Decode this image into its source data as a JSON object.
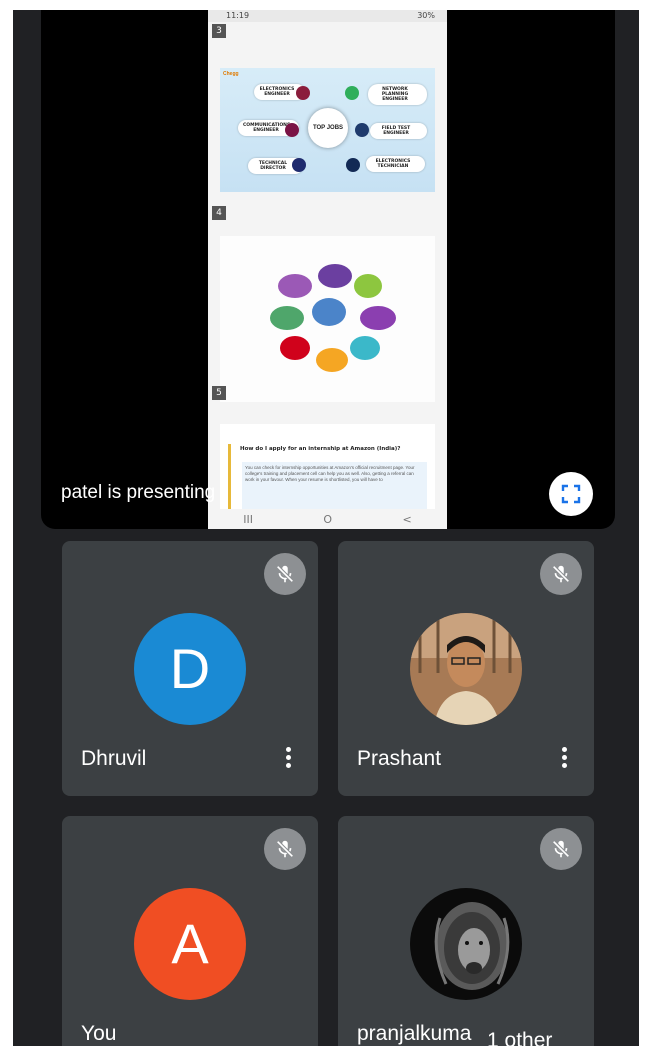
{
  "presentation": {
    "status_time": "11:19",
    "status_right": "30%",
    "pages": [
      "3",
      "4",
      "5"
    ],
    "slide1": {
      "logo": "Chegg",
      "hub": "TOP JOBS",
      "jobs": [
        "ELECTRONICS ENGINEER",
        "NETWORK PLANNING ENGINEER",
        "COMMUNICATIONS ENGINEER",
        "FIELD TEST ENGINEER",
        "TECHNICAL DIRECTOR",
        "ELECTRONICS TECHNICIAN"
      ]
    },
    "slide3": {
      "title": "How do I apply for an internship at Amazon (India)?",
      "body": "You can check for internship opportunities at Amazon's official recruitment page. Your college's training and placement cell can help you as well. Also, getting a referral can work in your favour. When your resume is shortlisted, you will have to"
    },
    "presenting_label": "patel is presenting",
    "fullscreen_icon": "fullscreen-icon",
    "nav": [
      "III",
      "O",
      "<"
    ]
  },
  "participants": [
    {
      "name": "Dhruvil",
      "initial": "D",
      "avatar_color": "#1a8ad4",
      "muted": true
    },
    {
      "name": "Prashant",
      "initial": "",
      "muted": true
    },
    {
      "name": "You",
      "initial": "A",
      "avatar_color": "#f04e23",
      "muted": true
    },
    {
      "name": "pranjalkuma",
      "initial": "",
      "muted": true
    }
  ],
  "other_chip": "1 other",
  "colors": {
    "background": "#202124",
    "tile": "#3c4043",
    "mic_bg": "#8d9093",
    "accent_blue": "#1a73e8"
  }
}
